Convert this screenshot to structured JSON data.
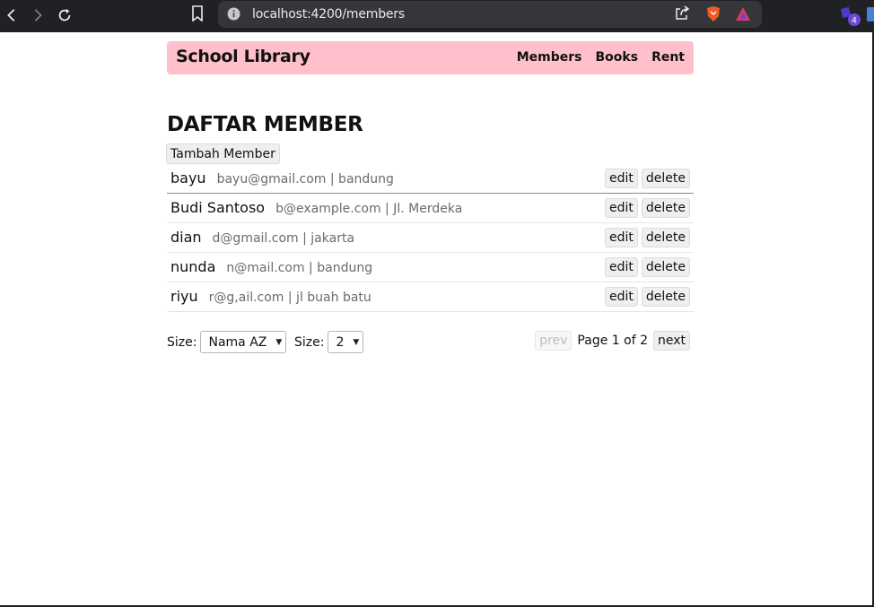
{
  "browser": {
    "url": "localhost:4200/members",
    "extension_badge": "4"
  },
  "navbar": {
    "brand": "School Library",
    "links": [
      "Members",
      "Books",
      "Rent"
    ],
    "bg_color": "#ffc0cb"
  },
  "page": {
    "title": "DAFTAR MEMBER",
    "add_button": "Tambah Member"
  },
  "members": [
    {
      "name": "bayu",
      "detail": "bayu@gmail.com | bandung",
      "edit": "edit",
      "delete": "delete"
    },
    {
      "name": "Budi Santoso",
      "detail": "b@example.com | Jl. Merdeka",
      "edit": "edit",
      "delete": "delete"
    },
    {
      "name": "dian",
      "detail": "d@gmail.com | jakarta",
      "edit": "edit",
      "delete": "delete"
    },
    {
      "name": "nunda",
      "detail": "n@mail.com | bandung",
      "edit": "edit",
      "delete": "delete"
    },
    {
      "name": "riyu",
      "detail": "r@g,ail.com | jl buah batu",
      "edit": "edit",
      "delete": "delete"
    }
  ],
  "toolbar": {
    "sort_label": "Size:",
    "sort_value": "Nama AZ",
    "size_label": "Size:",
    "size_value": "2",
    "prev": "prev",
    "page_info": "Page 1 of 2",
    "next": "next"
  }
}
